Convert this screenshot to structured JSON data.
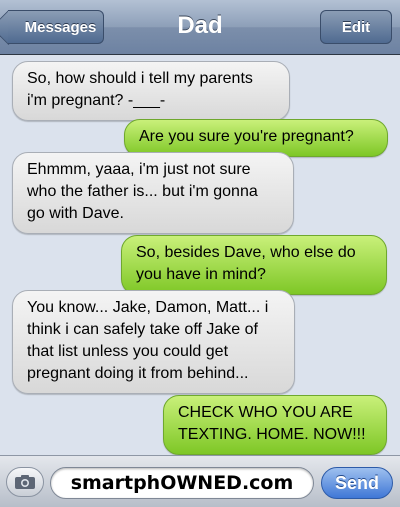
{
  "header": {
    "back_label": "Messages",
    "title": "Dad",
    "edit_label": "Edit"
  },
  "messages": [
    {
      "direction": "received",
      "text": "So, how should i tell my parents\ni'm pregnant? -___-"
    },
    {
      "direction": "sent",
      "text": "Are you sure you're pregnant?"
    },
    {
      "direction": "received",
      "text": "Ehmmm, yaaa, i'm just not sure\nwho the father is... but i'm gonna\ngo with Dave."
    },
    {
      "direction": "sent",
      "text": "So, besides Dave, who else do\nyou have in mind?"
    },
    {
      "direction": "received",
      "text": "You know... Jake, Damon, Matt... i\nthink i can safely take off Jake of\nthat list unless you could get\npregnant doing it from behind..."
    },
    {
      "direction": "sent",
      "text": "CHECK WHO YOU ARE\nTEXTING. HOME. NOW!!!"
    }
  ],
  "composer": {
    "field_text": "smartphOWNED.com",
    "send_label": "Send",
    "camera_icon": "camera-icon"
  },
  "colors": {
    "sent_bubble": "#7ec726",
    "received_bubble": "#d8d8d8",
    "nav_bar": "#6d82a2",
    "send_button": "#3f77d6"
  }
}
